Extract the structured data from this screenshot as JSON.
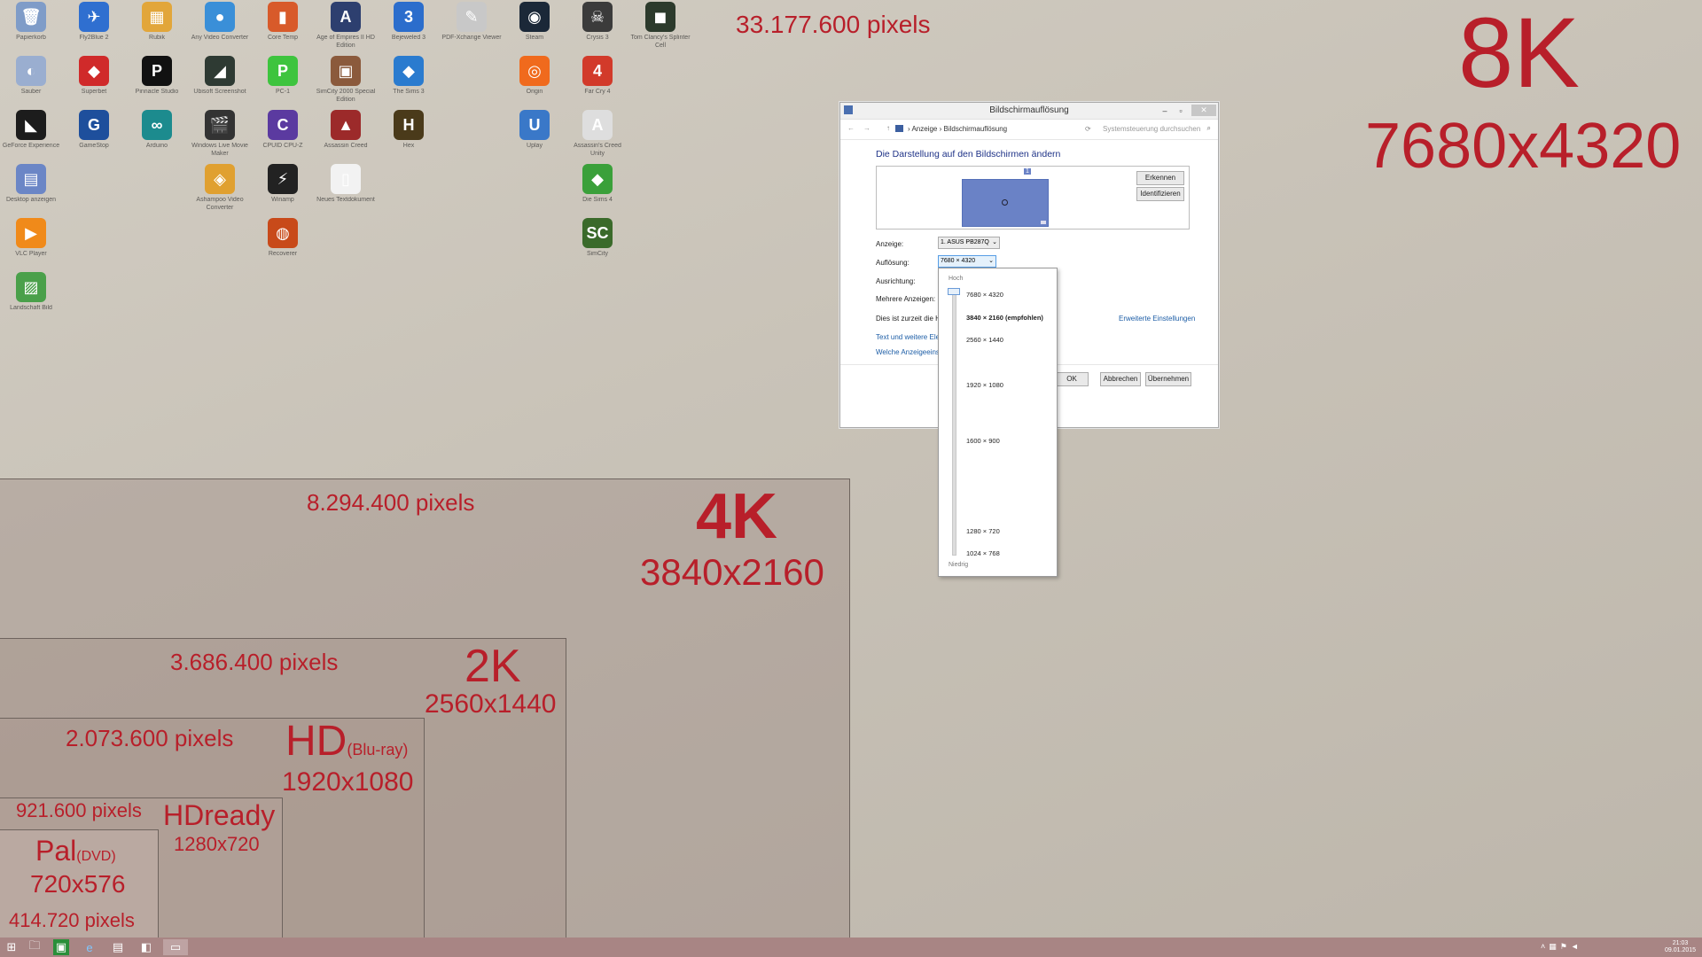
{
  "wallpaper": {
    "pixels_8k": "33.177.600 pixels",
    "label_8k": "8K",
    "res_8k": "7680x4320",
    "pixels_4k": "8.294.400 pixels",
    "label_4k": "4K",
    "res_4k": "3840x2160",
    "pixels_2k": "3.686.400 pixels",
    "label_2k": "2K",
    "res_2k": "2560x1440",
    "pixels_hd": "2.073.600 pixels",
    "label_hd": "HD",
    "sub_hd": "(Blu-ray)",
    "res_hd": "1920x1080",
    "pixels_hdready": "921.600 pixels",
    "label_hdready": "HDready",
    "res_hdready": "1280x720",
    "label_pal": "Pal",
    "sub_pal": "(DVD)",
    "res_pal": "720x576",
    "pixels_pal": "414.720 pixels"
  },
  "desktop_icons": [
    {
      "label": "Papierkorb",
      "color": "#7f9cc8",
      "glyph": "🗑"
    },
    {
      "label": "Fly2Blue 2",
      "color": "#2f6fd0",
      "glyph": "✈"
    },
    {
      "label": "Rubik",
      "color": "#e2a63a",
      "glyph": "▦"
    },
    {
      "label": "Any Video Converter",
      "color": "#3a8fd8",
      "glyph": "●"
    },
    {
      "label": "Core Temp",
      "color": "#d85a2a",
      "glyph": "▮"
    },
    {
      "label": "Age of Empires II HD Edition",
      "color": "#2d3f6f",
      "glyph": "A"
    },
    {
      "label": "Bejeweled 3",
      "color": "#2b6dcc",
      "glyph": "3"
    },
    {
      "label": "PDF-Xchange Viewer",
      "color": "#c8c8c8",
      "glyph": "✎"
    },
    {
      "label": "Steam",
      "color": "#1b2838",
      "glyph": "◉"
    },
    {
      "label": "Crysis 3",
      "color": "#3b3b3b",
      "glyph": "☠"
    },
    {
      "label": "Tom Clancy's Splinter Cell",
      "color": "#2c3a2c",
      "glyph": "◼"
    },
    {
      "label": "Sauber",
      "color": "#9aaed0",
      "glyph": "◐"
    },
    {
      "label": "Superbet",
      "color": "#d02a2a",
      "glyph": "◆"
    },
    {
      "label": "Pinnacle Studio",
      "color": "#111111",
      "glyph": "P"
    },
    {
      "label": "Ubisoft Screenshot",
      "color": "#2e3a33",
      "glyph": "◢"
    },
    {
      "label": "PC-1",
      "color": "#3ec43e",
      "glyph": "P"
    },
    {
      "label": "SimCity 2000 Special Edition",
      "color": "#8b5a3c",
      "glyph": "▣"
    },
    {
      "label": "The Sims 3",
      "color": "#2a7bcf",
      "glyph": "◆"
    },
    {
      "label": "Origin",
      "color": "#f06a1d",
      "glyph": "◎"
    },
    {
      "label": "Far Cry 4",
      "color": "#d23a2a",
      "glyph": "4"
    },
    {
      "label": "GeForce Experience",
      "color": "#1c1c1c",
      "glyph": "◣"
    },
    {
      "label": "GameStop",
      "color": "#1e4f9c",
      "glyph": "G"
    },
    {
      "label": "Arduino",
      "color": "#1c8b8e",
      "glyph": "∞"
    },
    {
      "label": "Windows Live Movie Maker",
      "color": "#333333",
      "glyph": "🎬"
    },
    {
      "label": "CPUID CPU-Z",
      "color": "#5b3aa0",
      "glyph": "C"
    },
    {
      "label": "Assassin Creed",
      "color": "#9c2a2a",
      "glyph": "▲"
    },
    {
      "label": "Hex",
      "color": "#4a3a1a",
      "glyph": "H"
    },
    {
      "label": "Uplay",
      "color": "#3a78c8",
      "glyph": "U"
    },
    {
      "label": "Assassin's Creed Unity",
      "color": "#dedede",
      "glyph": "A"
    },
    {
      "label": "Desktop anzeigen",
      "color": "#6b86c6",
      "glyph": "▤"
    },
    {
      "label": "Ashampoo Video Converter",
      "color": "#e0a030",
      "glyph": "◈"
    },
    {
      "label": "Winamp",
      "color": "#222222",
      "glyph": "⚡"
    },
    {
      "label": "Neues Textdokument",
      "color": "#f2f2f2",
      "glyph": "▯"
    },
    {
      "label": "Die Sims 4",
      "color": "#3aa03a",
      "glyph": "◆"
    },
    {
      "label": "VLC Player",
      "color": "#f08a1a",
      "glyph": "▶"
    },
    {
      "label": "Recoverer",
      "color": "#c84a1a",
      "glyph": "◍"
    },
    {
      "label": "SimCity",
      "color": "#3a6a2a",
      "glyph": "SC"
    },
    {
      "label": "Landschaft Bild",
      "color": "#4aa04a",
      "glyph": "▨"
    }
  ],
  "dialog": {
    "title": "Bildschirmauflösung",
    "breadcrumb_1": "Anzeige",
    "breadcrumb_2": "Bildschirmauflösung",
    "search_placeholder": "Systemsteuerung durchsuchen",
    "heading": "Die Darstellung auf den Bildschirmen ändern",
    "monitor_number": "1",
    "detect_label": "Erkennen",
    "identify_label": "Identifizieren",
    "display_label": "Anzeige:",
    "display_value": "1. ASUS PB287Q",
    "resolution_label": "Auflösung:",
    "resolution_value": "7680 × 4320",
    "orientation_label": "Ausrichtung:",
    "multiple_label": "Mehrere Anzeigen:",
    "current_text": "Dies ist zurzeit die Ha",
    "advanced_link": "Erweiterte Einstellungen",
    "text_link": "Text und weitere Elem",
    "which_link": "Welche Anzeigeeinst",
    "ok_label": "OK",
    "cancel_label": "Abbrechen",
    "apply_label": "Übernehmen"
  },
  "dropdown": {
    "high_label": "Hoch",
    "low_label": "Niedrig",
    "options": [
      "7680 × 4320",
      "3840 × 2160 (empfohlen)",
      "2560 × 1440",
      "1920 × 1080",
      "1600 × 900",
      "1280 × 720",
      "1024 × 768"
    ],
    "slider_level": 1.0
  },
  "taskbar": {
    "clock_time": "21:03",
    "clock_date": "09.01.2015"
  }
}
